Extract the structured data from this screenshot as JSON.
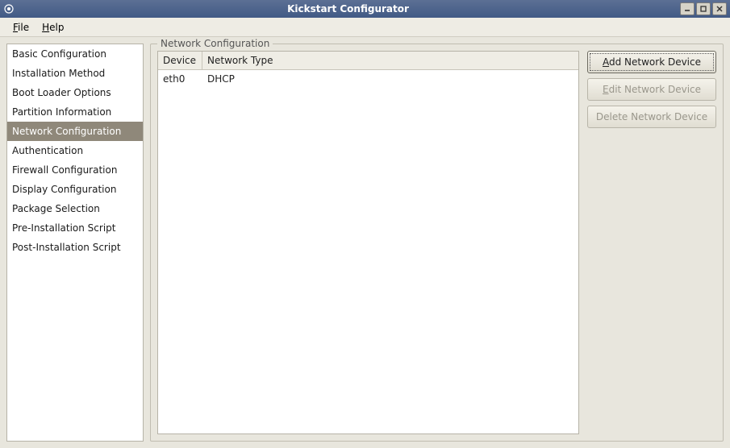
{
  "window": {
    "title": "Kickstart Configurator"
  },
  "menubar": {
    "file": "File",
    "help": "Help"
  },
  "sidebar": {
    "items": [
      {
        "label": "Basic Configuration"
      },
      {
        "label": "Installation Method"
      },
      {
        "label": "Boot Loader Options"
      },
      {
        "label": "Partition Information"
      },
      {
        "label": "Network Configuration"
      },
      {
        "label": "Authentication"
      },
      {
        "label": "Firewall Configuration"
      },
      {
        "label": "Display Configuration"
      },
      {
        "label": "Package Selection"
      },
      {
        "label": "Pre-Installation Script"
      },
      {
        "label": "Post-Installation Script"
      }
    ],
    "selected_index": 4
  },
  "panel": {
    "title": "Network Configuration",
    "table": {
      "columns": {
        "device": "Device",
        "type": "Network Type"
      },
      "rows": [
        {
          "device": "eth0",
          "type": "DHCP"
        }
      ]
    },
    "buttons": {
      "add": "Add Network Device",
      "edit": "Edit Network Device",
      "delete": "Delete Network Device"
    }
  }
}
